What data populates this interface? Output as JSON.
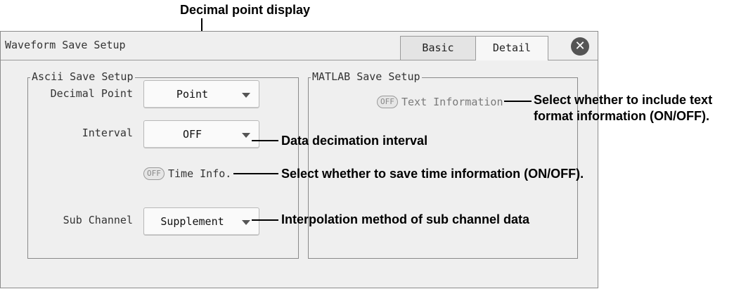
{
  "window": {
    "title": "Waveform Save Setup",
    "tabs": [
      {
        "label": "Basic",
        "active": false
      },
      {
        "label": "Detail",
        "active": true
      }
    ],
    "close_icon": "close-circle-icon"
  },
  "ascii_group": {
    "label": "Ascii Save Setup",
    "decimal_point": {
      "label": "Decimal Point",
      "value": "Point"
    },
    "interval": {
      "label": "Interval",
      "value": "OFF"
    },
    "time_info": {
      "toggle": "OFF",
      "label": "Time Info."
    },
    "sub_channel": {
      "label": "Sub Channel",
      "value": "Supplement"
    }
  },
  "matlab_group": {
    "label": "MATLAB Save Setup",
    "text_information": {
      "toggle": "OFF",
      "label": "Text Information"
    }
  },
  "callouts": {
    "decimal_point_display": "Decimal point display",
    "text_info_line1": "Select whether to include text",
    "text_info_line2": "format information (ON/OFF).",
    "interval": "Data decimation interval",
    "time_info": "Select whether to save time information (ON/OFF).",
    "sub_channel": "Interpolation method of sub channel data"
  },
  "colors": {
    "window_bg": "#efefef",
    "dropdown_bg": "#fafafa",
    "close_button": "#555555"
  }
}
